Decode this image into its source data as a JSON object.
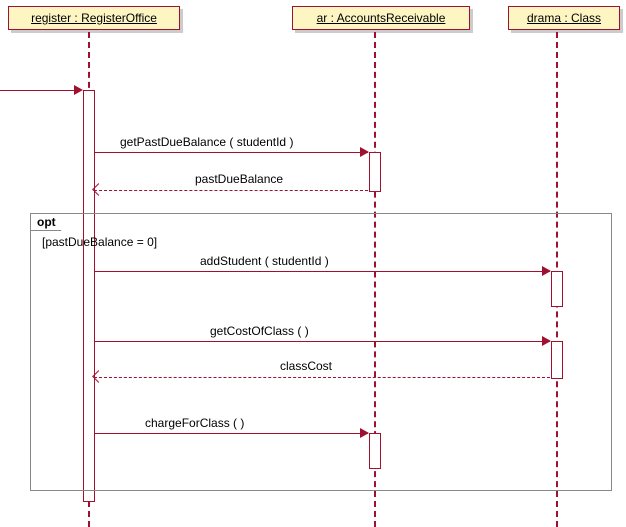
{
  "lifelines": {
    "register": "register : RegisterOffice",
    "ar": "ar : AccountsReceivable",
    "drama": "drama : Class"
  },
  "messages": {
    "getPastDue": "getPastDueBalance ( studentId )",
    "pastDueReturn": "pastDueBalance",
    "addStudent": "addStudent ( studentId )",
    "getCost": "getCostOfClass (  )",
    "classCostReturn": "classCost",
    "chargeForClass": "chargeForClass (  )"
  },
  "fragment": {
    "operator": "opt",
    "guard": "[pastDueBalance = 0]"
  },
  "chart_data": {
    "type": "sequence-diagram",
    "lifelines": [
      {
        "id": "register",
        "label": "register : RegisterOffice"
      },
      {
        "id": "ar",
        "label": "ar : AccountsReceivable"
      },
      {
        "id": "drama",
        "label": "drama : Class"
      }
    ],
    "messages": [
      {
        "from": "external",
        "to": "register",
        "label": "",
        "kind": "sync"
      },
      {
        "from": "register",
        "to": "ar",
        "label": "getPastDueBalance ( studentId )",
        "kind": "sync"
      },
      {
        "from": "ar",
        "to": "register",
        "label": "pastDueBalance",
        "kind": "return"
      },
      {
        "from": "register",
        "to": "drama",
        "label": "addStudent ( studentId )",
        "kind": "sync",
        "fragment": "opt"
      },
      {
        "from": "register",
        "to": "drama",
        "label": "getCostOfClass (  )",
        "kind": "sync",
        "fragment": "opt"
      },
      {
        "from": "drama",
        "to": "register",
        "label": "classCost",
        "kind": "return",
        "fragment": "opt"
      },
      {
        "from": "register",
        "to": "ar",
        "label": "chargeForClass (  )",
        "kind": "sync",
        "fragment": "opt"
      }
    ],
    "fragments": [
      {
        "operator": "opt",
        "guard": "[pastDueBalance = 0]",
        "covers": [
          "register",
          "ar",
          "drama"
        ]
      }
    ]
  }
}
